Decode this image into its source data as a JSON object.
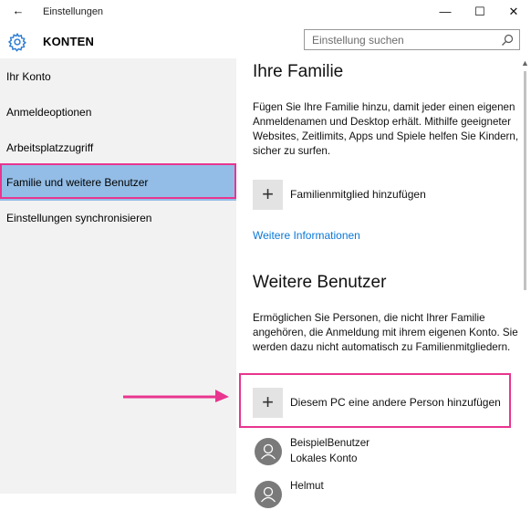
{
  "window": {
    "title": "Einstellungen",
    "minimize_glyph": "—",
    "maximize_glyph": "☐",
    "close_glyph": "✕",
    "back_glyph": "←"
  },
  "header": {
    "section": "KONTEN",
    "icon": "gear-icon"
  },
  "search": {
    "placeholder": "Einstellung suchen",
    "icon": "search-icon"
  },
  "sidebar": {
    "items": [
      {
        "label": "Ihr Konto"
      },
      {
        "label": "Anmeldeoptionen"
      },
      {
        "label": "Arbeitsplatzzugriff"
      },
      {
        "label": "Familie und weitere Benutzer"
      },
      {
        "label": "Einstellungen synchronisieren"
      }
    ],
    "selected_index": 3
  },
  "family": {
    "heading": "Ihre Familie",
    "description": "Fügen Sie Ihre Familie hinzu, damit jeder einen eigenen Anmeldenamen und Desktop erhält. Mithilfe geeigneter Websites, Zeitlimits, Apps und Spiele helfen Sie Kindern, sicher zu surfen.",
    "add_label": "Familienmitglied hinzufügen",
    "more_info_link": "Weitere Informationen"
  },
  "others": {
    "heading": "Weitere Benutzer",
    "description": "Ermöglichen Sie Personen, die nicht Ihrer Familie angehören, die Anmeldung mit ihrem eigenen Konto. Sie werden dazu nicht automatisch zu Familienmitgliedern.",
    "add_label": "Diesem PC eine andere Person hinzufügen",
    "users": [
      {
        "name": "BeispielBenutzer",
        "type": "Lokales Konto"
      },
      {
        "name": "Helmut",
        "type": ""
      }
    ]
  },
  "colors": {
    "accent": "#0a78d7",
    "selection": "#93bde6",
    "highlight": "#e8358f",
    "sidebar_bg": "#f2f2f2"
  },
  "plus_glyph": "+"
}
